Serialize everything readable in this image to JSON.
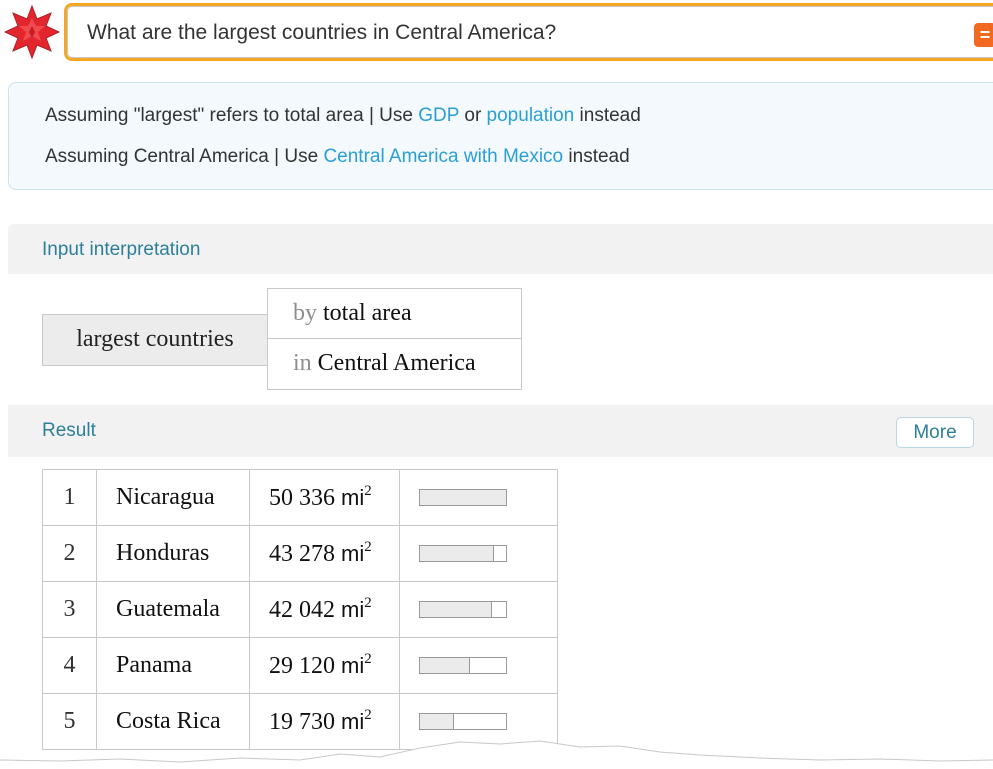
{
  "search": {
    "query": "What are the largest countries in Central America?",
    "equals_icon": "="
  },
  "assumptions": {
    "line1": {
      "text_before": "Assuming \"largest\" refers to total area | Use ",
      "link1": "GDP",
      "mid": " or ",
      "link2": "population",
      "text_after": " instead"
    },
    "line2": {
      "text_before": "Assuming Central America | Use ",
      "link": "Central America with Mexico",
      "text_after": " instead"
    }
  },
  "input_interpretation": {
    "title": "Input interpretation",
    "left": "largest countries",
    "row1_keyword": "by",
    "row1_value": "total area",
    "row2_keyword": "in",
    "row2_value": "Central America"
  },
  "result": {
    "title": "Result",
    "more_label": "More",
    "unit": "mi",
    "unit_exponent": "2",
    "rows": [
      {
        "rank": "1",
        "country": "Nicaragua",
        "area": "50 336",
        "bar_fraction": 1.0
      },
      {
        "rank": "2",
        "country": "Honduras",
        "area": "43 278",
        "bar_fraction": 0.86
      },
      {
        "rank": "3",
        "country": "Guatemala",
        "area": "42 042",
        "bar_fraction": 0.835
      },
      {
        "rank": "4",
        "country": "Panama",
        "area": "29 120",
        "bar_fraction": 0.579
      },
      {
        "rank": "5",
        "country": "Costa Rica",
        "area": "19 730",
        "bar_fraction": 0.392
      }
    ]
  },
  "colors": {
    "accent_orange": "#f5a623",
    "logo_red": "#e3262e",
    "link_blue": "#2a9fd6",
    "pod_title_teal": "#2d7f99"
  },
  "icons": {
    "logo": "wolfram-star-icon",
    "equals": "equals-icon"
  }
}
